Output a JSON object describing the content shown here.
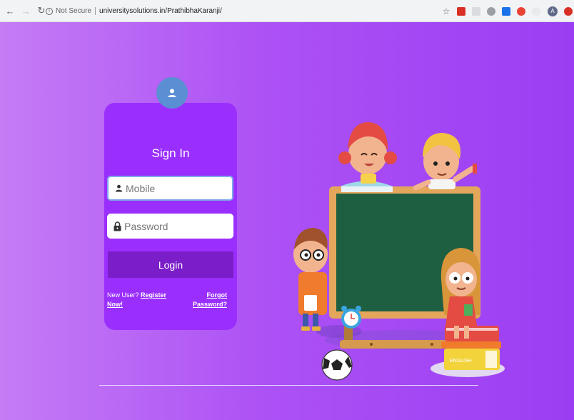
{
  "browser": {
    "security_label": "Not Secure",
    "url": "universitysolutions.in/PrathibhaKaranji/",
    "profile_initial": "A"
  },
  "login": {
    "title": "Sign In",
    "mobile_placeholder": "Mobile",
    "password_placeholder": "Password",
    "login_label": "Login",
    "new_user_prefix": "New User?",
    "register_label": "Register Now!",
    "forgot_label": "Forgot Password?"
  },
  "illustration": {
    "book_label": "ENGLISH"
  },
  "colors": {
    "page_gradient_start": "#c57cf5",
    "page_gradient_end": "#9a3ef3",
    "card": "#9a2ffd",
    "login_button": "#7b1ec9",
    "user_circle": "#5b8fd3"
  }
}
